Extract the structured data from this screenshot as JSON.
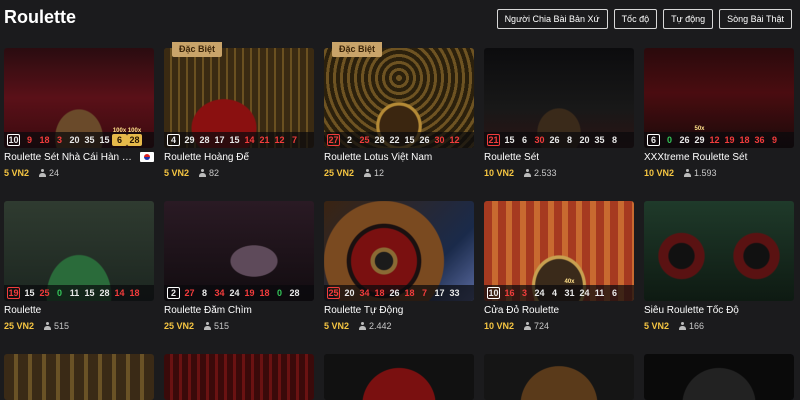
{
  "header": {
    "title": "Roulette",
    "filters": [
      {
        "label": "Người Chia Bài Bản Xứ"
      },
      {
        "label": "Tốc độ"
      },
      {
        "label": "Tự động"
      },
      {
        "label": "Sòng Bài Thật"
      }
    ]
  },
  "games": [
    {
      "title": "Roulette Sét Nhà Cái Hàn Qu...",
      "bet": "5 VN2",
      "players": "24",
      "badge": "",
      "flag": "korea-flag-icon",
      "results": [
        {
          "n": "10",
          "c": "black"
        },
        {
          "n": "9",
          "c": "red"
        },
        {
          "n": "18",
          "c": "red"
        },
        {
          "n": "3",
          "c": "red"
        },
        {
          "n": "20",
          "c": "black"
        },
        {
          "n": "35",
          "c": "black"
        },
        {
          "n": "15",
          "c": "black"
        },
        {
          "n": "6",
          "c": "gold",
          "m": "100x"
        },
        {
          "n": "28",
          "c": "gold",
          "m": "100x"
        }
      ]
    },
    {
      "title": "Roulette Hoàng Đế",
      "bet": "5 VN2",
      "players": "82",
      "badge": "Đặc Biệt",
      "results": [
        {
          "n": "4",
          "c": "black"
        },
        {
          "n": "29",
          "c": "black"
        },
        {
          "n": "28",
          "c": "black"
        },
        {
          "n": "17",
          "c": "black"
        },
        {
          "n": "15",
          "c": "black"
        },
        {
          "n": "14",
          "c": "red"
        },
        {
          "n": "21",
          "c": "red"
        },
        {
          "n": "12",
          "c": "red"
        },
        {
          "n": "7",
          "c": "red"
        }
      ]
    },
    {
      "title": "Roulette Lotus Việt Nam",
      "bet": "25 VN2",
      "players": "12",
      "badge": "Đặc Biệt",
      "results": [
        {
          "n": "27",
          "c": "red"
        },
        {
          "n": "2",
          "c": "black"
        },
        {
          "n": "25",
          "c": "red"
        },
        {
          "n": "28",
          "c": "black"
        },
        {
          "n": "22",
          "c": "black"
        },
        {
          "n": "15",
          "c": "black"
        },
        {
          "n": "26",
          "c": "black"
        },
        {
          "n": "30",
          "c": "red"
        },
        {
          "n": "12",
          "c": "red"
        }
      ]
    },
    {
      "title": "Roulette Sét",
      "bet": "10 VN2",
      "players": "2.533",
      "badge": "",
      "results": [
        {
          "n": "21",
          "c": "red"
        },
        {
          "n": "15",
          "c": "black"
        },
        {
          "n": "6",
          "c": "black"
        },
        {
          "n": "30",
          "c": "red"
        },
        {
          "n": "26",
          "c": "black"
        },
        {
          "n": "8",
          "c": "black"
        },
        {
          "n": "20",
          "c": "black"
        },
        {
          "n": "35",
          "c": "black"
        },
        {
          "n": "8",
          "c": "black"
        }
      ]
    },
    {
      "title": "XXXtreme Roulette Sét",
      "bet": "10 VN2",
      "players": "1.593",
      "badge": "",
      "results": [
        {
          "n": "6",
          "c": "black"
        },
        {
          "n": "0",
          "c": "green"
        },
        {
          "n": "26",
          "c": "black"
        },
        {
          "n": "29",
          "c": "black",
          "m": "50x"
        },
        {
          "n": "12",
          "c": "red"
        },
        {
          "n": "19",
          "c": "red"
        },
        {
          "n": "18",
          "c": "red"
        },
        {
          "n": "36",
          "c": "red"
        },
        {
          "n": "9",
          "c": "red"
        }
      ]
    },
    {
      "title": "Roulette",
      "bet": "25 VN2",
      "players": "515",
      "badge": "",
      "results": [
        {
          "n": "19",
          "c": "red"
        },
        {
          "n": "15",
          "c": "black"
        },
        {
          "n": "25",
          "c": "red"
        },
        {
          "n": "0",
          "c": "green"
        },
        {
          "n": "11",
          "c": "black"
        },
        {
          "n": "15",
          "c": "black"
        },
        {
          "n": "28",
          "c": "black"
        },
        {
          "n": "14",
          "c": "red"
        },
        {
          "n": "18",
          "c": "red"
        }
      ]
    },
    {
      "title": "Roulette Đắm Chìm",
      "bet": "25 VN2",
      "players": "515",
      "badge": "",
      "results": [
        {
          "n": "2",
          "c": "black"
        },
        {
          "n": "27",
          "c": "red"
        },
        {
          "n": "8",
          "c": "black"
        },
        {
          "n": "34",
          "c": "red"
        },
        {
          "n": "24",
          "c": "black"
        },
        {
          "n": "19",
          "c": "red"
        },
        {
          "n": "18",
          "c": "red"
        },
        {
          "n": "0",
          "c": "green"
        },
        {
          "n": "28",
          "c": "black"
        }
      ]
    },
    {
      "title": "Roulette Tự Động",
      "bet": "5 VN2",
      "players": "2.442",
      "badge": "",
      "results": [
        {
          "n": "25",
          "c": "red"
        },
        {
          "n": "20",
          "c": "black"
        },
        {
          "n": "34",
          "c": "red"
        },
        {
          "n": "18",
          "c": "red"
        },
        {
          "n": "26",
          "c": "black"
        },
        {
          "n": "18",
          "c": "red"
        },
        {
          "n": "7",
          "c": "red"
        },
        {
          "n": "17",
          "c": "black"
        },
        {
          "n": "33",
          "c": "black"
        }
      ]
    },
    {
      "title": "Cửa Đỏ Roulette",
      "bet": "10 VN2",
      "players": "724",
      "badge": "",
      "results": [
        {
          "n": "10",
          "c": "black"
        },
        {
          "n": "16",
          "c": "red"
        },
        {
          "n": "3",
          "c": "red"
        },
        {
          "n": "24",
          "c": "black"
        },
        {
          "n": "4",
          "c": "black"
        },
        {
          "n": "31",
          "c": "black",
          "m": "40x"
        },
        {
          "n": "24",
          "c": "black"
        },
        {
          "n": "11",
          "c": "black"
        },
        {
          "n": "6",
          "c": "black"
        }
      ]
    },
    {
      "title": "Siêu Roulette Tốc Độ",
      "bet": "5 VN2",
      "players": "166",
      "badge": "",
      "results": []
    }
  ]
}
